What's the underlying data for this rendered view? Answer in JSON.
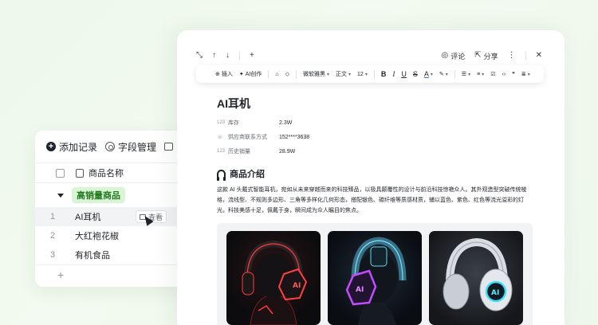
{
  "table": {
    "toolbar": {
      "add_record": "添加记录",
      "field_manage": "字段管理"
    },
    "header": {
      "column_name": "商品名称"
    },
    "group": {
      "label": "高销量商品"
    },
    "rows": [
      {
        "num": "1",
        "name": "AI耳机"
      },
      {
        "num": "2",
        "name": "大红袍花椒"
      },
      {
        "num": "3",
        "name": "有机食品"
      }
    ],
    "view_button": "查看",
    "add_row": "+"
  },
  "doc": {
    "topbar": {
      "comment": "评论",
      "share": "分享"
    },
    "format": {
      "insert": "插入",
      "ai_create": "AI创作",
      "font": "微软雅黑",
      "style": "正文",
      "size": "12"
    },
    "title": "AI耳机",
    "props": [
      {
        "icon": "123",
        "label": "库存",
        "value": "2.3W"
      },
      {
        "icon": "phone-icon",
        "label": "供应商联系方式",
        "value": "152****3638"
      },
      {
        "icon": "123",
        "label": "历史销量",
        "value": "28.9W"
      }
    ],
    "section_title": "商品介绍",
    "description": "这款 AI 头戴式智能耳机，宛如从未来穿越而来的科技臻品，以极具颠覆性的设计与前沿科技惊艳众人。其外观造型突破传统棱格，流线型、不规则多边形、三角等多样化几何形态，搭配银色、碳纤维等质感材质，辅以蓝色、紫色、红色等流光溢彩的灯光，科技美感十足，佩戴于身，瞬间成为众人瞩目的焦点。",
    "images": [
      {
        "name": "red-headphone-image",
        "badge": "AI"
      },
      {
        "name": "purple-headphone-image",
        "badge": "AI"
      },
      {
        "name": "cyan-headphone-image",
        "badge": "AI"
      }
    ]
  },
  "colors": {
    "accent_green": "#237a20",
    "tag_bg": "#d9f5d6",
    "text_primary": "#1f2329"
  }
}
